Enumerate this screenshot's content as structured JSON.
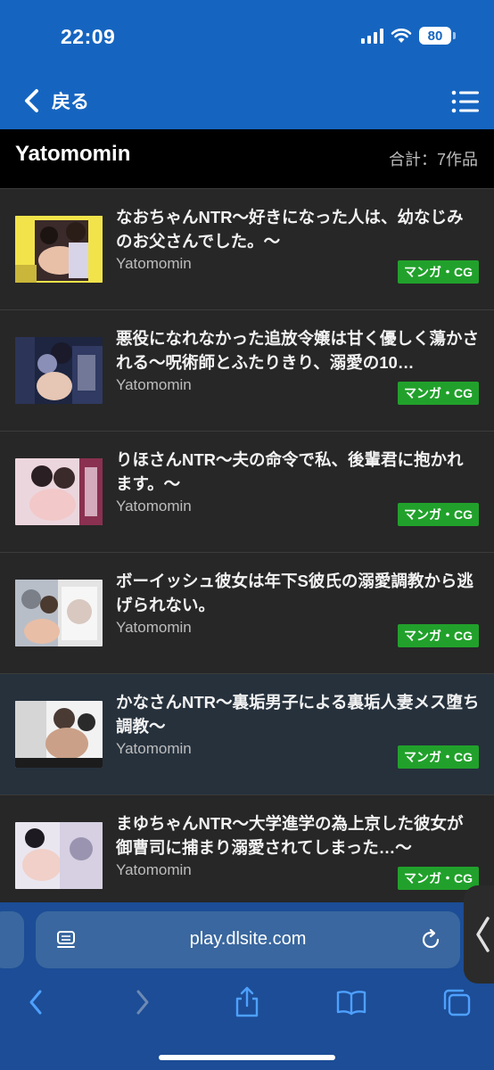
{
  "status": {
    "time": "22:09",
    "battery": "80"
  },
  "nav": {
    "back_label": "戻る"
  },
  "header": {
    "author": "Yatomomin",
    "total": "合計：7作品"
  },
  "items": [
    {
      "title": "なおちゃんNTR〜好きになった人は、幼なじみのお父さんでした。〜",
      "author": "Yatomomin",
      "badge": "マンガ・CG"
    },
    {
      "title": "悪役になれなかった追放令嬢は甘く優しく蕩かされる〜呪術師とふたりきり、溺愛の10…",
      "author": "Yatomomin",
      "badge": "マンガ・CG"
    },
    {
      "title": "りほさんNTR〜夫の命令で私、後輩君に抱かれます。〜",
      "author": "Yatomomin",
      "badge": "マンガ・CG"
    },
    {
      "title": "ボーイッシュ彼女は年下S彼氏の溺愛調教から逃げられない。",
      "author": "Yatomomin",
      "badge": "マンガ・CG"
    },
    {
      "title": "かなさんNTR〜裏垢男子による裏垢人妻メス堕ち調教〜",
      "author": "Yatomomin",
      "badge": "マンガ・CG"
    },
    {
      "title": "まゆちゃんNTR〜大学進学の為上京した彼女が御曹司に捕まり溺愛されてしまった…〜",
      "author": "Yatomomin",
      "badge": "マンガ・CG"
    }
  ],
  "browser": {
    "url": "play.dlsite.com"
  },
  "colors": {
    "nav_blue": "#1565c0",
    "badge_green": "#21a12b",
    "safari_bar": "#1c4d96"
  }
}
